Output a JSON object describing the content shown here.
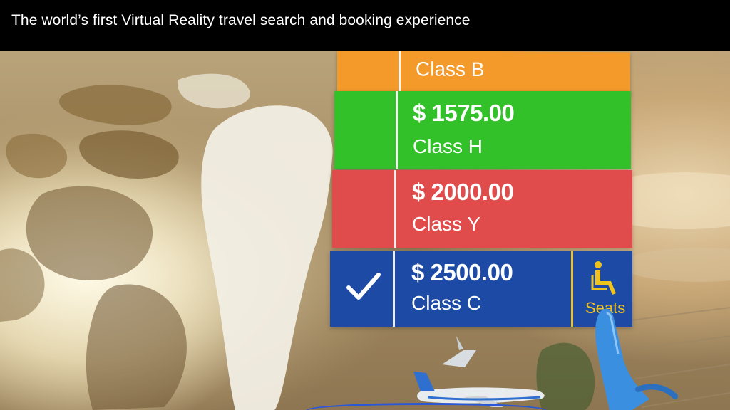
{
  "header": {
    "title": "The world’s first Virtual Reality travel search and booking experience"
  },
  "fares": [
    {
      "price": "",
      "class_label": "Class B",
      "color": "#f39a2a",
      "selected": false
    },
    {
      "price": "$ 1575.00",
      "class_label": "Class H",
      "color": "#33c12a",
      "selected": false
    },
    {
      "price": "$ 2000.00",
      "class_label": "Class Y",
      "color": "#e04c4c",
      "selected": false
    },
    {
      "price": "$ 2500.00",
      "class_label": "Class C",
      "color": "#1d4aa5",
      "selected": true
    }
  ],
  "seats": {
    "label": "Seats",
    "icon": "seat-icon",
    "color": "#f0c21e"
  },
  "icons": {
    "check": "check-icon",
    "pointer": "vr-pointer-icon",
    "plane": "airplane-icon"
  }
}
